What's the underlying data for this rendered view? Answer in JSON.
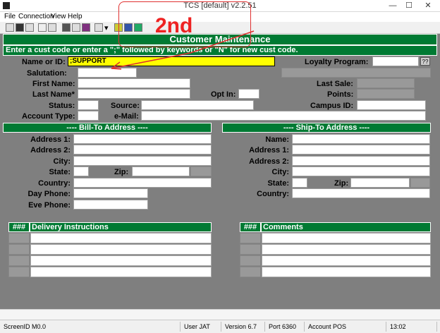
{
  "window": {
    "title": "TCS [default]  v2.2.51",
    "minimize": "—",
    "maximize": "☐",
    "close": "✕"
  },
  "menu": [
    "File",
    "Connection",
    "View",
    "Help"
  ],
  "form": {
    "header": "Customer Maintenance",
    "instruction": "Enter a cust code or enter a \";\" followed by keywords or \"N\" for new cust code.",
    "name_or_id_label": "Name or ID:",
    "name_or_id_value": ";SUPPORT",
    "loyalty_label": "Loyalty Program:",
    "loyalty_help": "??",
    "salutation_label": "Salutation:",
    "first_name_label": "First Name:",
    "last_name_label": "Last Name*",
    "opt_in_label": "Opt In:",
    "last_sale_label": "Last Sale:",
    "points_label": "Points:",
    "status_label": "Status:",
    "source_label": "Source:",
    "campus_id_label": "Campus ID:",
    "account_type_label": "Account Type:",
    "email_label": "e-Mail:"
  },
  "bill_to": {
    "header": "---- Bill-To Address ----",
    "address1": "Address 1:",
    "address2": "Address 2:",
    "city": "City:",
    "state": "State:",
    "zip": "Zip:",
    "country": "Country:",
    "day_phone": "Day Phone:",
    "eve_phone": "Eve Phone:"
  },
  "ship_to": {
    "header": "---- Ship-To Address ----",
    "name": "Name:",
    "address1": "Address 1:",
    "address2": "Address 2:",
    "city": "City:",
    "state": "State:",
    "zip": "Zip:",
    "country": "Country:"
  },
  "delivery": {
    "num_header": "###",
    "title": "Delivery Instructions"
  },
  "comments": {
    "num_header": "###",
    "title": "Comments"
  },
  "annotation": {
    "text": "2nd",
    "color": "#ee2222"
  },
  "status_bar": {
    "screen_id": "ScreenID M0.0",
    "user": "User JAT",
    "version": "Version 6.7",
    "port": "Port 6360",
    "account": "Account POS",
    "time": "13:02"
  },
  "colors": {
    "green": "#007a33",
    "panel": "#7f7f7f",
    "highlight": "#ffff00"
  }
}
